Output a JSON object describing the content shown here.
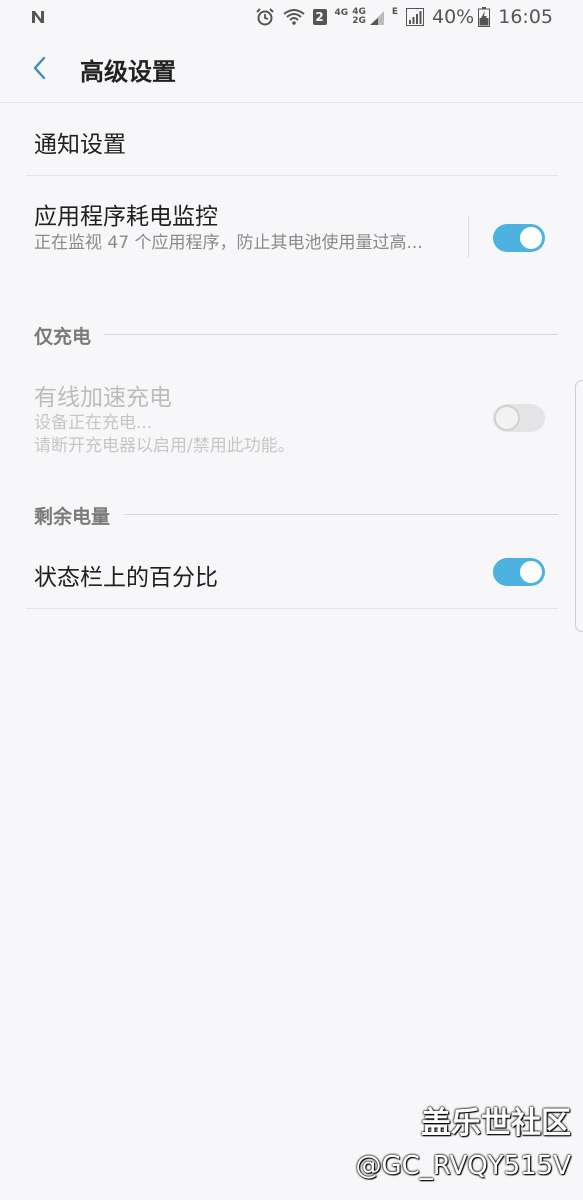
{
  "status_bar": {
    "left_icon": "n-notification-icon",
    "network_small_1": "4G",
    "network_small_2_top": "4G",
    "network_small_2_bottom": "2G",
    "network_small_3": "E",
    "badge": "2",
    "battery_percent": "40%",
    "time": "16:05"
  },
  "header": {
    "title": "高级设置"
  },
  "items": {
    "notification_settings": {
      "title": "通知设置"
    },
    "app_power_monitor": {
      "title": "应用程序耗电监控",
      "subtitle": "正在监视 47 个应用程序，防止其电池使用量过高...",
      "enabled": true
    },
    "section_charging": {
      "label": "仅充电"
    },
    "fast_wired_charging": {
      "title": "有线加速充电",
      "subtitle_line1": "设备正在充电...",
      "subtitle_line2": "请断开充电器以启用/禁用此功能。",
      "enabled": false,
      "disabled": true
    },
    "section_remaining": {
      "label": "剩余电量"
    },
    "percent_in_status_bar": {
      "title": "状态栏上的百分比",
      "enabled": true
    }
  },
  "watermark": {
    "line1": "盖乐世社区",
    "line2": "@GC_RVQY515V"
  },
  "colors": {
    "accent": "#4db2e0",
    "background": "#f7f7f9",
    "title_text": "#202020",
    "subtitle_text": "#8a8a8a"
  }
}
